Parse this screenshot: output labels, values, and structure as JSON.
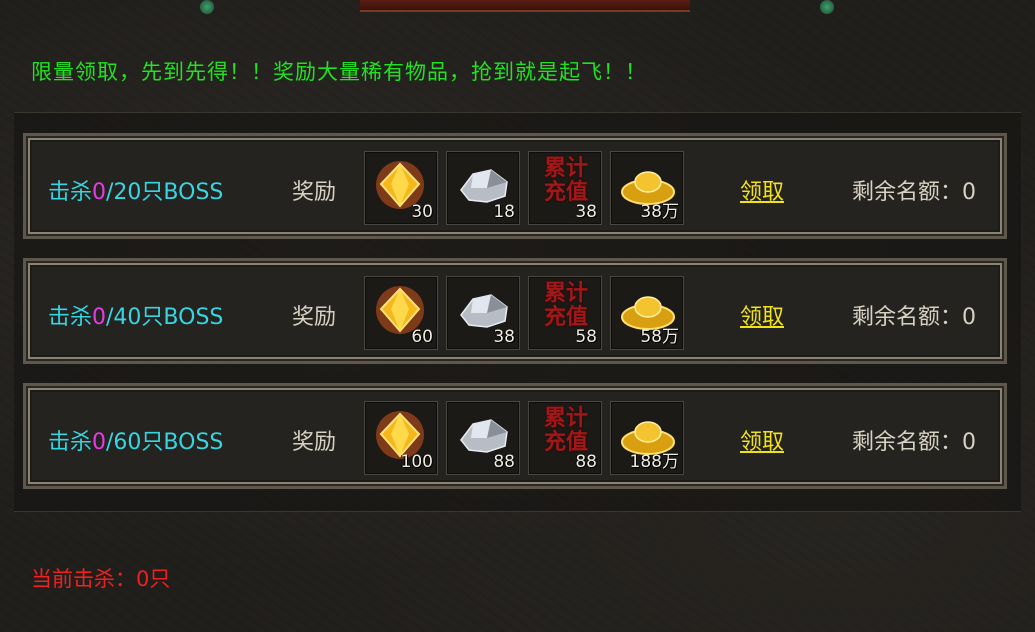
{
  "notice": "限量领取，先到先得！！奖励大量稀有物品，抢到就是起飞！！",
  "reward_label": "奖励",
  "claim_label": "领取",
  "charge_label": "累计充值",
  "rows": [
    {
      "kill_prefix": "击杀",
      "kill_current": "0",
      "kill_suffix": "/20只BOSS",
      "rewards": [
        "30",
        "18",
        "38",
        "38万"
      ],
      "quota": "剩余名额：0"
    },
    {
      "kill_prefix": "击杀",
      "kill_current": "0",
      "kill_suffix": "/40只BOSS",
      "rewards": [
        "60",
        "38",
        "58",
        "58万"
      ],
      "quota": "剩余名额：0"
    },
    {
      "kill_prefix": "击杀",
      "kill_current": "0",
      "kill_suffix": "/60只BOSS",
      "rewards": [
        "100",
        "88",
        "88",
        "188万"
      ],
      "quota": "剩余名额：0"
    }
  ],
  "current_kills": "当前击杀：0只",
  "colors": {
    "notice": "#22e022",
    "kill": "#35d6e2",
    "kill_current": "#e23ce2",
    "claim": "#f2e21a",
    "current_kills": "#ee2020"
  },
  "icons": [
    "gold-gem-icon",
    "silver-ore-icon",
    "charge-icon",
    "gold-ingot-icon"
  ]
}
